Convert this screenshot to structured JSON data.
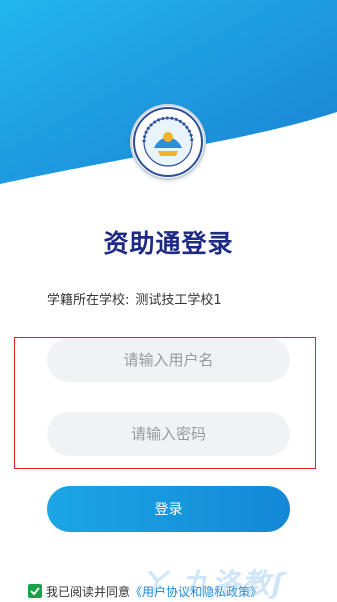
{
  "header": {
    "gradient_start": "#1fb4ec",
    "gradient_end": "#1a7fd2"
  },
  "logo": {
    "name": "school-emblem-logo"
  },
  "title": "资助通登录",
  "school": {
    "label": "学籍所在学校:",
    "value": "测试技工学校1"
  },
  "form": {
    "username_placeholder": "请输入用户名",
    "password_placeholder": "请输入密码",
    "login_label": "登录"
  },
  "agreement": {
    "checked": true,
    "prefix": "我已阅读并同意",
    "link": "《用户协议和隐私政策》"
  },
  "watermark": "ㄚ 九洛教ʃ"
}
